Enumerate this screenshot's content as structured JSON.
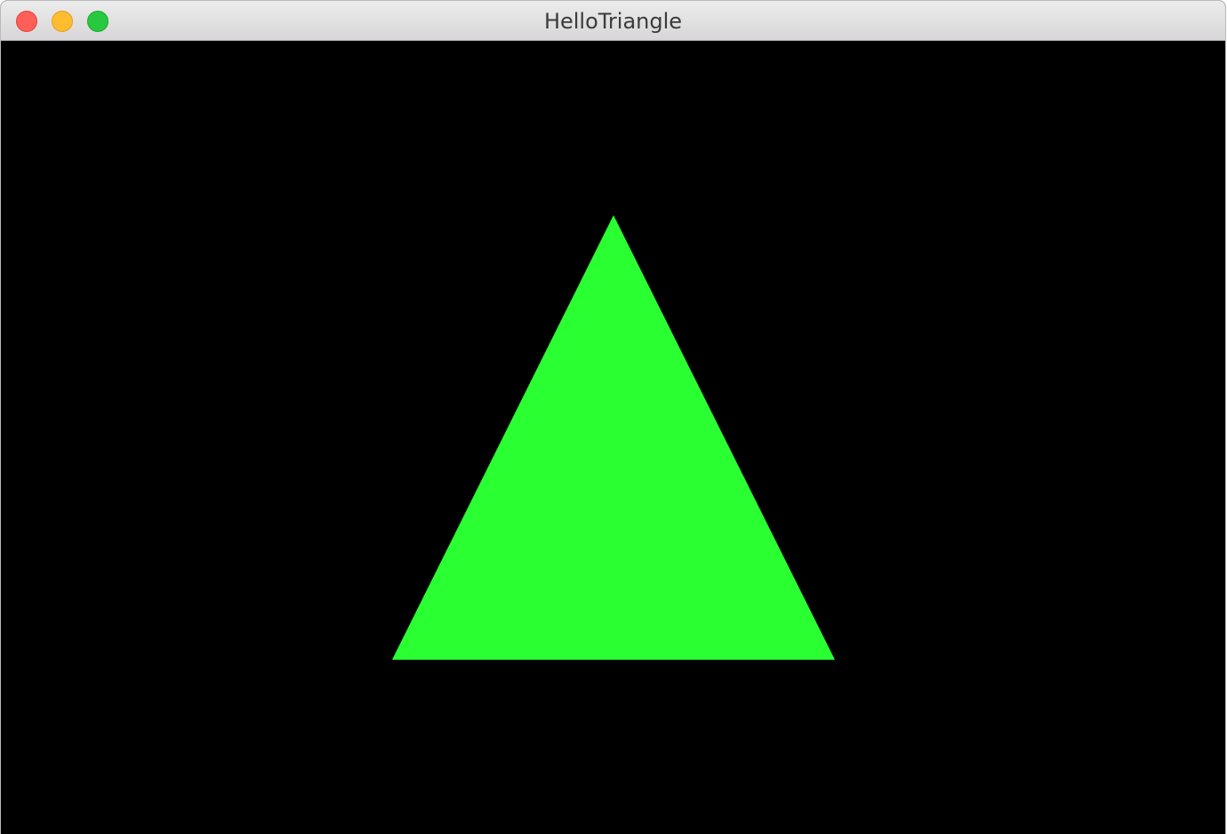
{
  "window": {
    "title": "HelloTriangle",
    "controls": {
      "close": "close",
      "minimize": "minimize",
      "zoom": "zoom"
    }
  },
  "viewport": {
    "background_color": "#000000",
    "triangle_color": "#2aff32"
  }
}
